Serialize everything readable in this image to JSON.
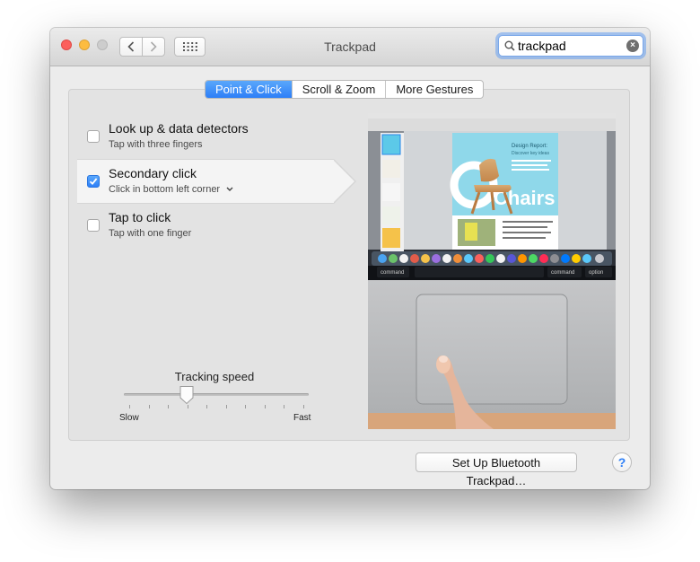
{
  "window": {
    "title": "Trackpad"
  },
  "search": {
    "value": "trackpad"
  },
  "tabs": [
    {
      "label": "Point & Click",
      "active": true
    },
    {
      "label": "Scroll & Zoom",
      "active": false
    },
    {
      "label": "More Gestures",
      "active": false
    }
  ],
  "options": [
    {
      "title": "Look up & data detectors",
      "subtitle": "Tap with three fingers",
      "checked": false
    },
    {
      "title": "Secondary click",
      "subtitle": "Click in bottom left corner",
      "checked": true
    },
    {
      "title": "Tap to click",
      "subtitle": "Tap with one finger",
      "checked": false
    }
  ],
  "tracking": {
    "label": "Tracking speed",
    "min_label": "Slow",
    "max_label": "Fast",
    "value_fraction": 0.34
  },
  "preview": {
    "doc_heading": "Design Report:",
    "doc_subheading": "Discover key ideas",
    "doc_big_text": "Chairs",
    "key_labels": [
      "command",
      "command",
      "option"
    ]
  },
  "footer": {
    "bluetooth_button": "Set Up Bluetooth Trackpad…",
    "help_button": "?"
  },
  "colors": {
    "accent": "#2d7ff7",
    "close": "#fc605c",
    "minimize": "#fdbc40"
  }
}
